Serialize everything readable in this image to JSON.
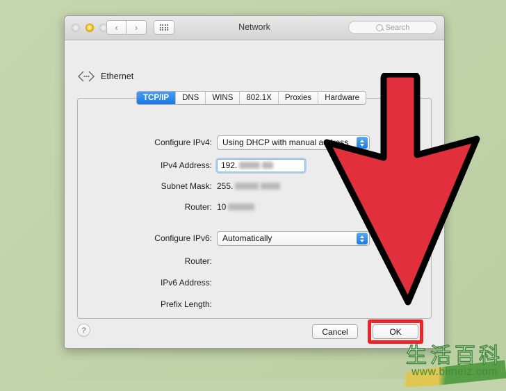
{
  "window": {
    "title": "Network",
    "search_placeholder": "Search",
    "traffic_lights": [
      "close",
      "minimize",
      "zoom"
    ],
    "nav_back": "‹",
    "nav_forward": "›",
    "grid_icon": "grid-icon"
  },
  "service": {
    "name": "Ethernet",
    "icon": "ethernet-icon"
  },
  "tabs": [
    {
      "label": "TCP/IP",
      "selected": true
    },
    {
      "label": "DNS",
      "selected": false
    },
    {
      "label": "WINS",
      "selected": false
    },
    {
      "label": "802.1X",
      "selected": false
    },
    {
      "label": "Proxies",
      "selected": false
    },
    {
      "label": "Hardware",
      "selected": false
    }
  ],
  "form": {
    "configure_ipv4_label": "Configure IPv4:",
    "configure_ipv4_value": "Using DHCP with manual address",
    "ipv4_address_label": "IPv4 Address:",
    "ipv4_address_value": "192.",
    "subnet_mask_label": "Subnet Mask:",
    "subnet_mask_value": "255.",
    "router_label": "Router:",
    "router_value": "10",
    "configure_ipv6_label": "Configure IPv6:",
    "configure_ipv6_value": "Automatically",
    "ipv6_router_label": "Router:",
    "ipv6_router_value": "",
    "ipv6_address_label": "IPv6 Address:",
    "ipv6_address_value": "",
    "prefix_length_label": "Prefix Length:",
    "prefix_length_value": ""
  },
  "buttons": {
    "help": "?",
    "cancel": "Cancel",
    "ok": "OK"
  },
  "annotation": {
    "arrow": "down-arrow-annotation",
    "arrow_color": "#e1303c",
    "highlight_color": "#e8252b"
  },
  "watermark": {
    "chinese": "生活百科",
    "url": "www.bimeiz.com"
  },
  "theme": {
    "background": "#c3d4ac",
    "accent": "#1877e0",
    "window_bg": "#ececec"
  }
}
